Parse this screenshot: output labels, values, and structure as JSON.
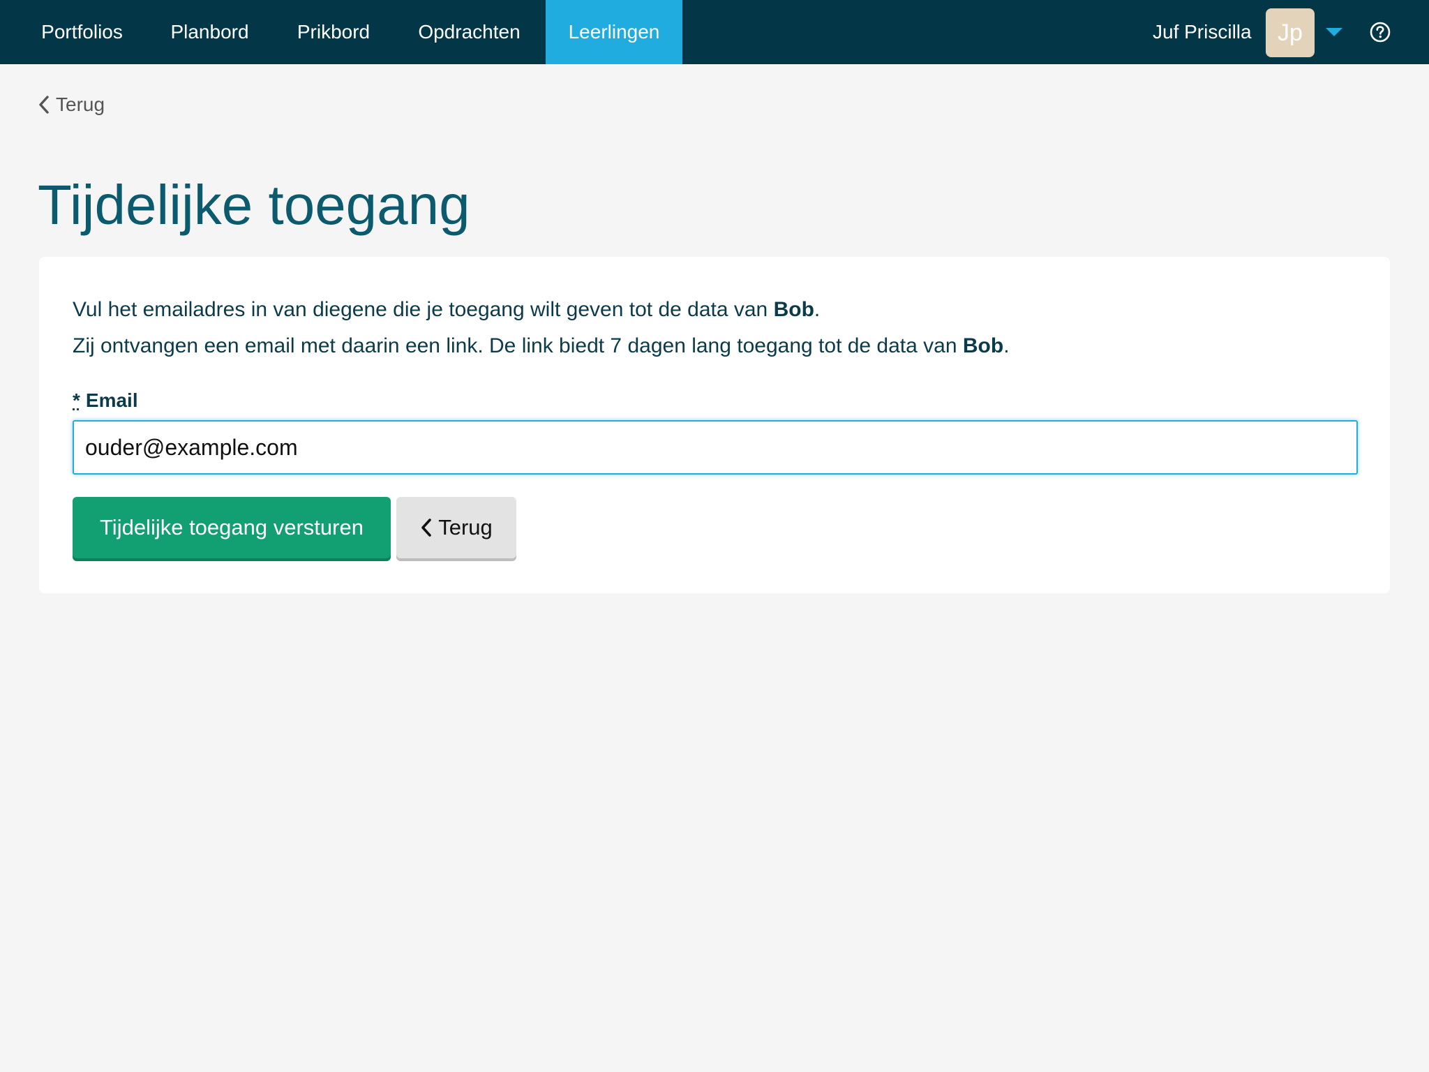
{
  "nav": {
    "items": [
      {
        "label": "Portfolios"
      },
      {
        "label": "Planbord"
      },
      {
        "label": "Prikbord"
      },
      {
        "label": "Opdrachten"
      },
      {
        "label": "Leerlingen",
        "active": true
      }
    ],
    "user_name": "Juf Priscilla",
    "avatar_initials": "Jp",
    "dropdown_icon": "caret-down-icon",
    "help_icon": "question-circle-icon"
  },
  "back_link": {
    "label": "Terug",
    "icon": "chevron-left-icon"
  },
  "page": {
    "title": "Tijdelijke toegang"
  },
  "form": {
    "intro_line1_prefix": "Vul het emailadres in van diegene die je toegang wilt geven tot de data van ",
    "intro_line2_prefix": "Zij ontvangen een email met daarin een link. De link biedt 7 dagen lang toegang tot de data van ",
    "student_name": "Bob",
    "period": ".",
    "email_required_marker": "*",
    "email_label": "Email",
    "email_value": "ouder@example.com",
    "submit_label": "Tijdelijke toegang versturen",
    "back_label": "Terug"
  },
  "colors": {
    "topbar": "#033747",
    "active_tab": "#21acdf",
    "title": "#0b5a6e",
    "primary_button": "#129f72",
    "avatar": "#e3d3bb"
  }
}
